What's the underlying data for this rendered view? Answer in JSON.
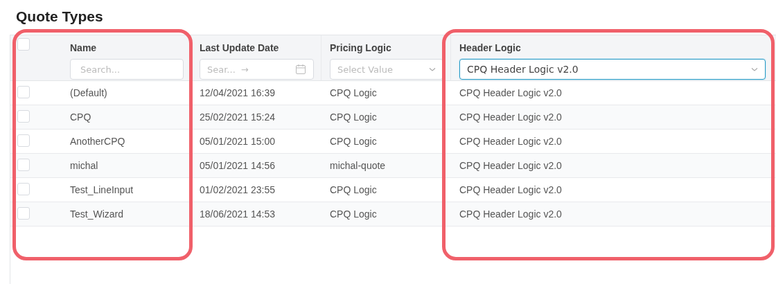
{
  "page": {
    "title": "Quote Types"
  },
  "table": {
    "select_column": {
      "highlighted": true,
      "checked": false
    },
    "columns": [
      {
        "label": "Name",
        "highlighted": true,
        "filter": {
          "kind": "search",
          "placeholder": "Search..."
        }
      },
      {
        "label": "Last Update Date",
        "highlighted": false,
        "filter": {
          "kind": "daterange",
          "placeholder": "Sear...",
          "separator": "→"
        }
      },
      {
        "label": "Pricing Logic",
        "highlighted": false,
        "filter": {
          "kind": "select",
          "placeholder": "Select Value",
          "focused": false
        }
      },
      {
        "label": "Header Logic",
        "highlighted": true,
        "filter": {
          "kind": "select",
          "value": "CPQ Header Logic v2.0",
          "focused": true
        }
      }
    ],
    "rows": [
      {
        "checked": false,
        "cells": [
          "(Default)",
          "12/04/2021 16:39",
          "CPQ Logic",
          "CPQ Header Logic v2.0"
        ]
      },
      {
        "checked": false,
        "cells": [
          "CPQ",
          "25/02/2021 15:24",
          "CPQ Logic",
          "CPQ Header Logic v2.0"
        ]
      },
      {
        "checked": false,
        "cells": [
          "AnotherCPQ",
          "05/01/2021 15:00",
          "CPQ Logic",
          "CPQ Header Logic v2.0"
        ]
      },
      {
        "checked": false,
        "cells": [
          "michal",
          "05/01/2021 14:56",
          "michal-quote",
          "CPQ Header Logic v2.0"
        ]
      },
      {
        "checked": false,
        "cells": [
          "Test_LineInput",
          "01/02/2021 23:55",
          "CPQ Logic",
          "CPQ Header Logic v2.0"
        ]
      },
      {
        "checked": false,
        "cells": [
          "Test_Wizard",
          "18/06/2021 14:53",
          "CPQ Logic",
          "CPQ Header Logic v2.0"
        ]
      }
    ]
  }
}
